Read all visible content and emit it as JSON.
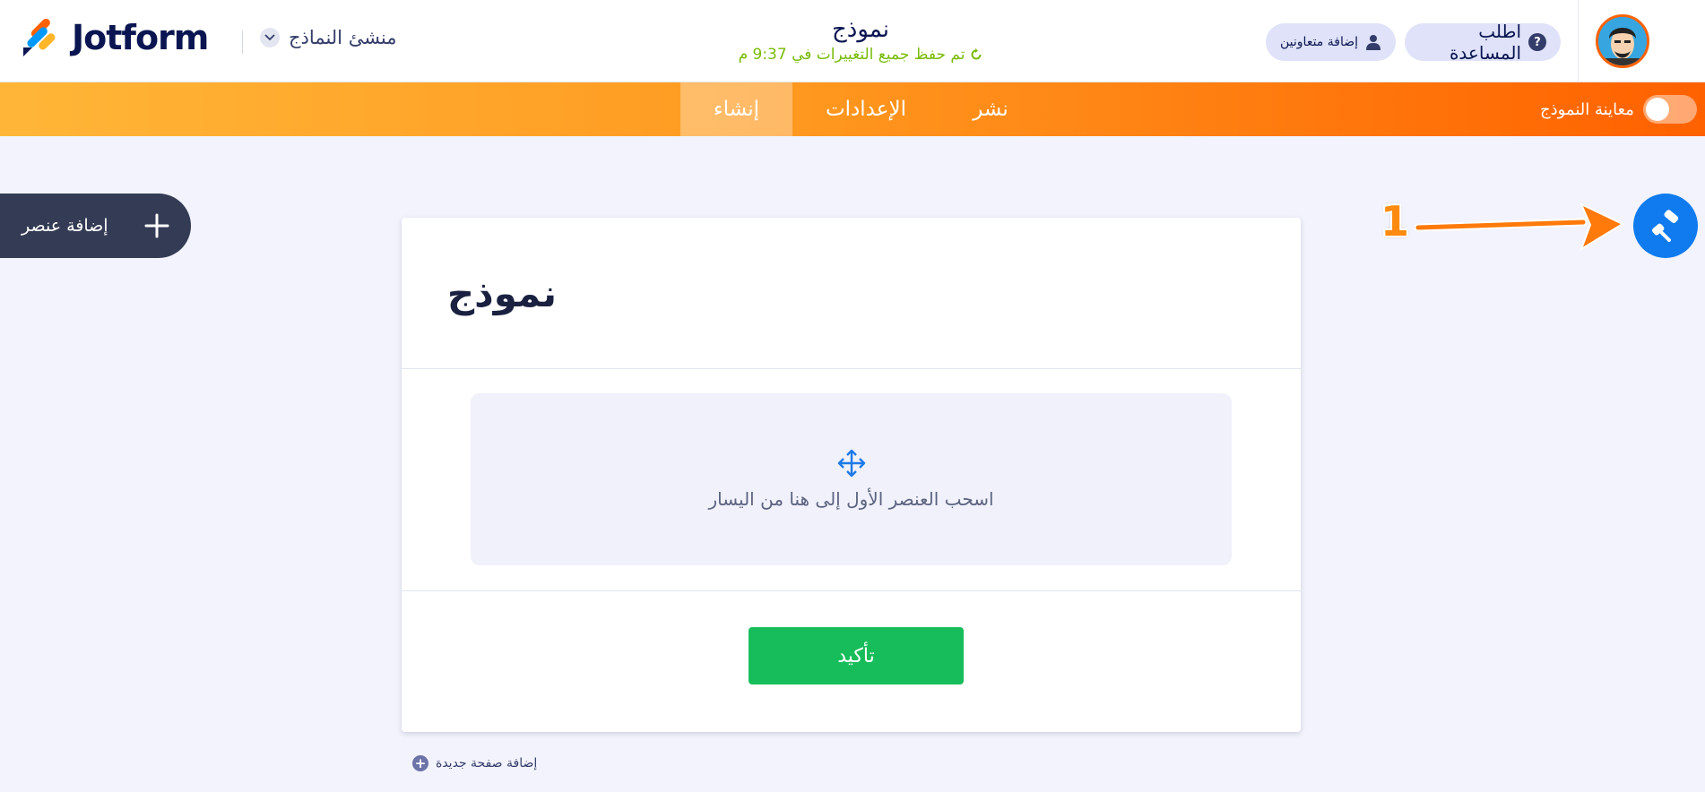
{
  "header": {
    "logo_text": "Jotform",
    "builder_label": "منشئ النماذج",
    "form_name": "نموذج",
    "save_status": "تم حفظ جميع التغييرات في 9:37 م",
    "help_label": "اطلب المساعدة",
    "help_icon": "?",
    "collab_label": "إضافة متعاونين"
  },
  "nav": {
    "tabs": [
      {
        "label": "إنشاء",
        "active": true
      },
      {
        "label": "الإعدادات",
        "active": false
      },
      {
        "label": "نشر",
        "active": false
      }
    ],
    "preview_label": "معاينة النموذج",
    "preview_on": false
  },
  "sidebar": {
    "add_element_label": "إضافة عنصر"
  },
  "annotation": {
    "number": "1"
  },
  "form": {
    "heading": "نموذج",
    "dropzone_text": "اسحب العنصر الأول إلى هنا من اليسار",
    "submit_label": "تأكيد",
    "add_page_label": "إضافة صفحة جديدة"
  },
  "colors": {
    "brand_navy": "#0a1551",
    "nav_orange_start": "#ffb638",
    "nav_orange_end": "#ff6100",
    "designer_blue": "#0f7bef",
    "submit_green": "#18bd5b",
    "save_green": "#78bb07"
  }
}
